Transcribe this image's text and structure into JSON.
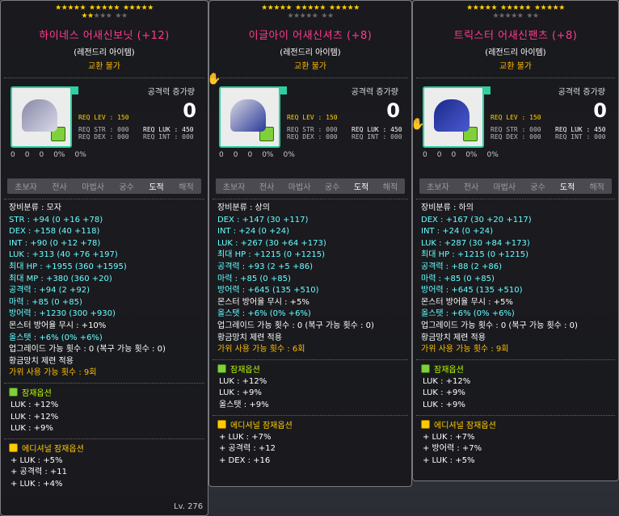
{
  "panels": [
    {
      "stars_on": 17,
      "stars_off": 5,
      "name": "하이네스 어새신보닛 (+12)",
      "grade": "(레전드리 아이템)",
      "trade": "교환 불가",
      "atk_label": "공격력 증가량",
      "atk_value": "0",
      "req": {
        "lev": "REQ LEV : 150",
        "str": "REQ STR : 000",
        "luk": "REQ LUK : 450",
        "dex": "REQ DEX : 000",
        "int": "REQ INT : 000"
      },
      "mini": [
        "0",
        "0",
        "0",
        "0%",
        "0%"
      ],
      "jobs": [
        "초보자",
        "전사",
        "마법사",
        "궁수",
        "도적",
        "해적"
      ],
      "active_job": 4,
      "stats": [
        {
          "t": "장비분류 : 모자",
          "c": "w"
        },
        {
          "t": "STR : +94 (0 +16 +78)",
          "c": "c"
        },
        {
          "t": "DEX : +158 (40 +118)",
          "c": "c"
        },
        {
          "t": "INT : +90 (0 +12 +78)",
          "c": "c"
        },
        {
          "t": "LUK : +313 (40 +76 +197)",
          "c": "c"
        },
        {
          "t": "최대 HP : +1955 (360 +1595)",
          "c": "c"
        },
        {
          "t": "최대 MP : +380 (360 +20)",
          "c": "c"
        },
        {
          "t": "공격력 : +94 (2 +92)",
          "c": "c"
        },
        {
          "t": "마력 : +85 (0 +85)",
          "c": "c"
        },
        {
          "t": "방어력 : +1230 (300 +930)",
          "c": "c"
        },
        {
          "t": "몬스터 방어율 무시 : +10%",
          "c": "w"
        },
        {
          "t": "올스탯 : +6% (0% +6%)",
          "c": "c"
        },
        {
          "t": "업그레이드 가능 횟수 : 0 (복구 가능 횟수 : 0)",
          "c": "w"
        },
        {
          "t": "황금망치 제련 적용",
          "c": "w"
        },
        {
          "t": "가위 사용 가능 횟수 : 9회",
          "c": "o"
        }
      ],
      "potential_title": "잠재옵션",
      "potential": [
        "LUK : +12%",
        "LUK : +12%",
        "LUK : +9%"
      ],
      "additional_title": "에디셔널 잠재옵션",
      "additional": [
        "+ LUK : +5%",
        "+ 공격력 : +11",
        "+ LUK : +4%"
      ]
    },
    {
      "stars_on": 15,
      "stars_off": 7,
      "name": "이글아이 어새신셔츠 (+8)",
      "grade": "(레전드리 아이템)",
      "trade": "교환 불가",
      "atk_label": "공격력 증가량",
      "atk_value": "0",
      "req": {
        "lev": "REQ LEV : 150",
        "str": "REQ STR : 000",
        "luk": "REQ LUK : 450",
        "dex": "REQ DEX : 000",
        "int": "REQ INT : 000"
      },
      "mini": [
        "0",
        "0",
        "0",
        "0%",
        "0%"
      ],
      "jobs": [
        "초보자",
        "전사",
        "마법사",
        "궁수",
        "도적",
        "해적"
      ],
      "active_job": 4,
      "stats": [
        {
          "t": "장비분류 : 상의",
          "c": "w"
        },
        {
          "t": "DEX : +147 (30 +117)",
          "c": "c"
        },
        {
          "t": "INT : +24 (0 +24)",
          "c": "c"
        },
        {
          "t": "LUK : +267 (30 +64 +173)",
          "c": "c"
        },
        {
          "t": "최대 HP : +1215 (0 +1215)",
          "c": "c"
        },
        {
          "t": "공격력 : +93 (2 +5 +86)",
          "c": "c"
        },
        {
          "t": "마력 : +85 (0 +85)",
          "c": "c"
        },
        {
          "t": "방어력 : +645 (135 +510)",
          "c": "c"
        },
        {
          "t": "몬스터 방어율 무시 : +5%",
          "c": "w"
        },
        {
          "t": "올스탯 : +6% (0% +6%)",
          "c": "c"
        },
        {
          "t": "업그레이드 가능 횟수 : 0 (복구 가능 횟수 : 0)",
          "c": "w"
        },
        {
          "t": "황금망치 제련 적용",
          "c": "w"
        },
        {
          "t": "가위 사용 가능 횟수 : 6회",
          "c": "o"
        }
      ],
      "potential_title": "잠재옵션",
      "potential": [
        "LUK : +12%",
        "LUK : +9%",
        "올스탯 : +9%"
      ],
      "additional_title": "에디셔널 잠재옵션",
      "additional": [
        "+ LUK : +7%",
        "+ 공격력 : +12",
        "+ DEX : +16"
      ]
    },
    {
      "stars_on": 15,
      "stars_off": 7,
      "name": "트릭스터 어새신팬츠 (+8)",
      "grade": "(레전드리 아이템)",
      "trade": "교환 불가",
      "atk_label": "공격력 증가량",
      "atk_value": "0",
      "req": {
        "lev": "REQ LEV : 150",
        "str": "REQ STR : 000",
        "luk": "REQ LUK : 450",
        "dex": "REQ DEX : 000",
        "int": "REQ INT : 000"
      },
      "mini": [
        "0",
        "0",
        "0",
        "0%",
        "0%"
      ],
      "jobs": [
        "초보자",
        "전사",
        "마법사",
        "궁수",
        "도적",
        "해적"
      ],
      "active_job": 4,
      "stats": [
        {
          "t": "장비분류 : 하의",
          "c": "w"
        },
        {
          "t": "DEX : +167 (30 +20 +117)",
          "c": "c"
        },
        {
          "t": "INT : +24 (0 +24)",
          "c": "c"
        },
        {
          "t": "LUK : +287 (30 +84 +173)",
          "c": "c"
        },
        {
          "t": "최대 HP : +1215 (0 +1215)",
          "c": "c"
        },
        {
          "t": "공격력 : +88 (2 +86)",
          "c": "c"
        },
        {
          "t": "마력 : +85 (0 +85)",
          "c": "c"
        },
        {
          "t": "방어력 : +645 (135 +510)",
          "c": "c"
        },
        {
          "t": "몬스터 방어율 무시 : +5%",
          "c": "w"
        },
        {
          "t": "올스탯 : +6% (0% +6%)",
          "c": "c"
        },
        {
          "t": "업그레이드 가능 횟수 : 0 (복구 가능 횟수 : 0)",
          "c": "w"
        },
        {
          "t": "황금망치 제련 적용",
          "c": "w"
        },
        {
          "t": "가위 사용 가능 횟수 : 9회",
          "c": "o"
        }
      ],
      "potential_title": "잠재옵션",
      "potential": [
        "LUK : +12%",
        "LUK : +9%",
        "LUK : +9%"
      ],
      "additional_title": "에디셔널 잠재옵션",
      "additional": [
        "+ LUK : +7%",
        "+ 방어력 : +7%",
        "+ LUK : +5%"
      ]
    }
  ],
  "corner_level": "Lv. 276",
  "colors": {
    "cyan": "#66ffff",
    "orange": "#ffbf00",
    "name": "#ff3c8c",
    "star": "#ffd200"
  }
}
